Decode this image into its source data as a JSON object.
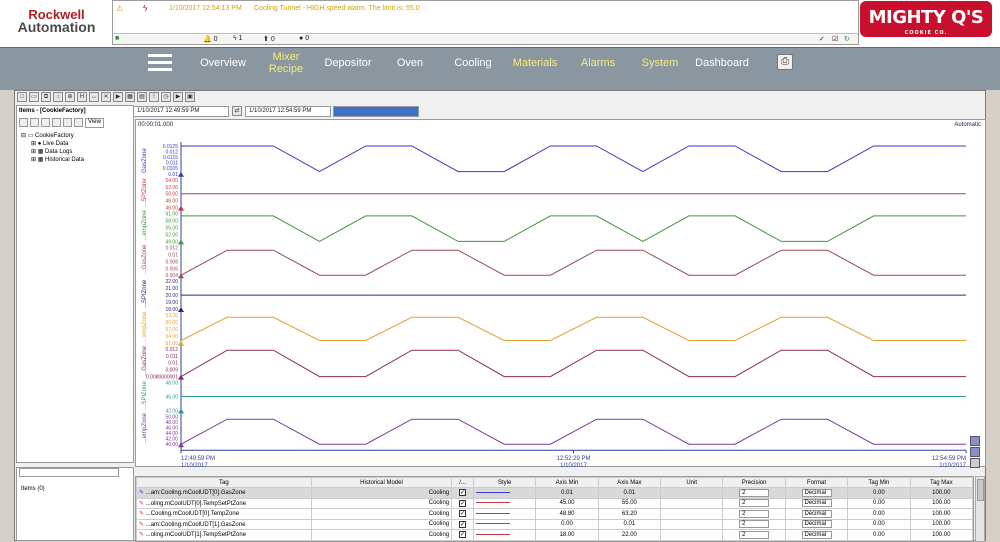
{
  "brand": {
    "left_line1": "Rockwell",
    "left_line2": "Automation",
    "right_main": "MIGHTY Q'S",
    "right_sub": "COOKIE CO."
  },
  "alarm": {
    "time": "1/10/2017 12:54:13 PM",
    "message": "Cooling Tunnel - HIGH speed alarm. The limit is: 55.0",
    "counts": [
      "0",
      "1",
      "0",
      "0"
    ]
  },
  "nav": {
    "items": [
      "Overview",
      "Mixer Recipe",
      "Depositor",
      "Oven",
      "Cooling",
      "Materials",
      "Alarms",
      "System",
      "Dashboard"
    ]
  },
  "toolbar": {
    "start_time": "1/10/2017 12:49:59 PM",
    "end_time": "1/10/2017 12:54:59 PM"
  },
  "tree": {
    "title": "Items - [CookieFactory]",
    "view": "View",
    "root": "CookieFactory",
    "children": [
      "Live Data",
      "Data Logs",
      "Historical Data"
    ],
    "items_label": "Items (0)"
  },
  "chart_data": {
    "type": "line",
    "elapsed": "00:00:01.000",
    "mode": "Automatic",
    "x_ticks": [
      {
        "time": "12:49:59 PM",
        "date": "1/10/2017"
      },
      {
        "time": "12:52:29 PM",
        "date": "1/10/2017"
      },
      {
        "time": "12:54:59 PM",
        "date": "1/10/2017"
      }
    ],
    "series": [
      {
        "name": "GasZone",
        "color": "#3a3ac8",
        "ticks": [
          "0.0125",
          "0.012",
          "0.0115",
          "0.011",
          "0.0105",
          "0.01"
        ],
        "values": [
          0.0125,
          0.0125,
          0.0125,
          0.0102,
          0.0125,
          0.0125,
          0.0102,
          0.0102,
          0.0125,
          0.0125,
          0.0102,
          0.0125,
          0.0125,
          0.0102,
          0.0102,
          0.0125,
          0.0125,
          0.0125
        ]
      },
      {
        "name": "...SPtZone",
        "color": "#c83a3a",
        "ticks": [
          "54.00",
          "52.00",
          "50.00",
          "48.00",
          "46.00"
        ],
        "values": [
          50,
          50,
          50,
          50,
          50,
          50,
          50,
          50,
          50,
          50,
          50,
          50,
          50,
          50,
          50,
          50,
          50,
          50
        ]
      },
      {
        "name": "...empZone",
        "color": "#3a9a3a",
        "ticks": [
          "61.00",
          "58.00",
          "55.00",
          "52.00",
          "49.00"
        ],
        "values": [
          60,
          60,
          60,
          49,
          60,
          60,
          49,
          49,
          60,
          60,
          49,
          60,
          60,
          49,
          49,
          60,
          60,
          60
        ]
      },
      {
        "name": "...GasZone",
        "color": "#9a4a5a",
        "ticks": [
          "0.012",
          "0.01",
          "0.008",
          "0.006",
          "0.004"
        ],
        "values": [
          0.004,
          0.0112,
          0.0112,
          0.004,
          0.004,
          0.0112,
          0.0112,
          0.004,
          0.004,
          0.0112,
          0.0112,
          0.004,
          0.004,
          0.0112,
          0.0112,
          0.004,
          0.004,
          0.004
        ]
      },
      {
        "name": "...SPtZone",
        "color": "#2a2a7a",
        "ticks": [
          "22.00",
          "21.00",
          "20.00",
          "19.00",
          "18.00"
        ],
        "values": [
          20,
          20,
          20,
          20,
          20,
          20,
          20,
          20,
          20,
          20,
          20,
          20,
          20,
          20,
          20,
          20,
          20,
          20
        ]
      },
      {
        "name": "...empZone",
        "color": "#e6a030",
        "ticks": [
          "63.00",
          "60.00",
          "57.00",
          "54.00",
          "51.00"
        ],
        "values": [
          52,
          62,
          62,
          52,
          52,
          62,
          62,
          52,
          52,
          62,
          62,
          52,
          52,
          62,
          62,
          52,
          52,
          52
        ]
      },
      {
        "name": "...GasZone",
        "color": "#8a2a5a",
        "ticks": [
          "0.012",
          "0.011",
          "0.01",
          "0.009",
          "0.0080000001"
        ],
        "values": [
          0.008,
          0.0118,
          0.0118,
          0.008,
          0.008,
          0.0118,
          0.0118,
          0.008,
          0.008,
          0.0118,
          0.0118,
          0.008,
          0.008,
          0.0118,
          0.0118,
          0.008,
          0.008,
          0.008
        ]
      },
      {
        "name": "...SPtZone",
        "color": "#2a9a9a",
        "ticks": [
          "48.00",
          "45.00",
          "42.00"
        ],
        "values": [
          45,
          45,
          45,
          45,
          45,
          45,
          45,
          45,
          45,
          45,
          45,
          45,
          45,
          45,
          45,
          45,
          45,
          45
        ]
      },
      {
        "name": "...empZone",
        "color": "#7a3a9a",
        "ticks": [
          "50.00",
          "48.00",
          "46.00",
          "44.00",
          "42.00",
          "40.00"
        ],
        "values": [
          40,
          49,
          49,
          40,
          40,
          49,
          49,
          40,
          40,
          49,
          49,
          40,
          40,
          49,
          49,
          40,
          40,
          40
        ]
      }
    ]
  },
  "table": {
    "headers": [
      "Tag",
      "Historical Model",
      "/...",
      "Style",
      "Axis Min",
      "Axis Max",
      "Unit",
      "Precision",
      "Format",
      "Tag Min",
      "Tag Max"
    ],
    "rows": [
      {
        "tag": "...am:Cooling.mCoolUDT[0].GasZone",
        "model": "Cooling",
        "axis_min": "0.01",
        "axis_max": "0.01",
        "precision": "2",
        "format": "Decimal",
        "tag_min": "0.00",
        "tag_max": "100.00",
        "color": "#3a3ac8",
        "selected": true
      },
      {
        "tag": "...oling.mCoolUDT[0].TempSetPtZone",
        "model": "Cooling",
        "axis_min": "45.00",
        "axis_max": "55.00",
        "precision": "2",
        "format": "Decimal",
        "tag_min": "0.00",
        "tag_max": "100.00",
        "color": "#c83a3a",
        "selected": false
      },
      {
        "tag": "...Cooling.mCoolUDT[0].TempZone",
        "model": "Cooling",
        "axis_min": "48.80",
        "axis_max": "63.20",
        "precision": "2",
        "format": "Decimal",
        "tag_min": "0.00",
        "tag_max": "100.00",
        "color": "#c83a3a",
        "selected": false
      },
      {
        "tag": "...am:Cooling.mCoolUDT[1].GasZone",
        "model": "Cooling",
        "axis_min": "0.00",
        "axis_max": "0.01",
        "precision": "2",
        "format": "Decimal",
        "tag_min": "0.00",
        "tag_max": "100.00",
        "color": "#c83a3a",
        "selected": false
      },
      {
        "tag": "...oling.mCoolUDT[1].TempSetPtZone",
        "model": "Cooling",
        "axis_min": "18.00",
        "axis_max": "22.00",
        "precision": "2",
        "format": "Decimal",
        "tag_min": "0.00",
        "tag_max": "100.00",
        "color": "#c83a3a",
        "selected": false
      }
    ]
  }
}
